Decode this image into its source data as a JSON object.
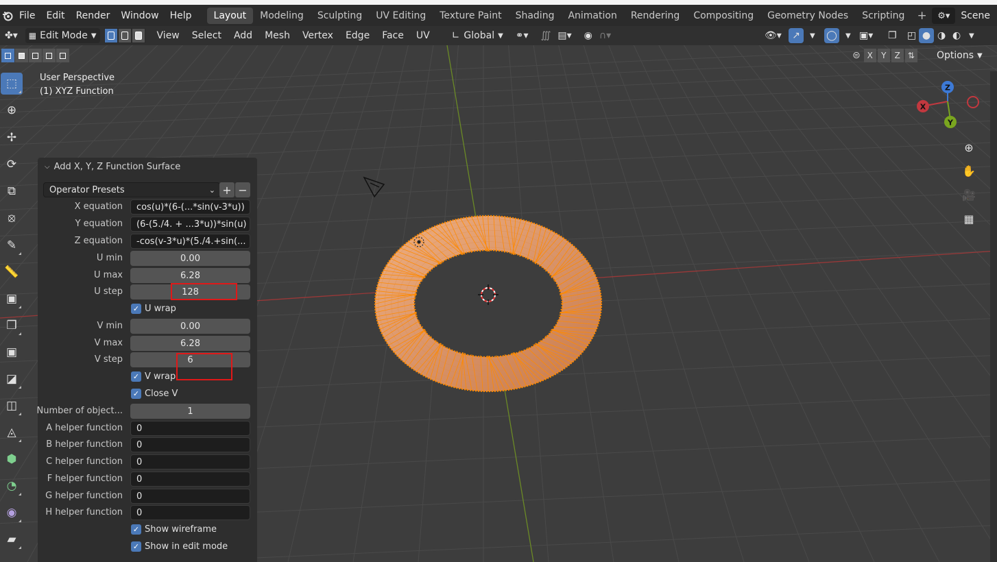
{
  "menubar": {
    "items": [
      "File",
      "Edit",
      "Render",
      "Window",
      "Help"
    ],
    "workspaces": [
      "Layout",
      "Modeling",
      "Sculpting",
      "UV Editing",
      "Texture Paint",
      "Shading",
      "Animation",
      "Rendering",
      "Compositing",
      "Geometry Nodes",
      "Scripting"
    ],
    "active_workspace": "Layout",
    "add_workspace": "+",
    "scene": "Scene"
  },
  "header": {
    "mode": "Edit Mode",
    "menus": [
      "View",
      "Select",
      "Add",
      "Mesh",
      "Vertex",
      "Edge",
      "Face",
      "UV"
    ],
    "transform_orientation": "Global"
  },
  "viewport": {
    "perspective": "User Perspective",
    "object": "(1) XYZ Function",
    "axis_labels": {
      "x": "X",
      "y": "Y",
      "z": "Z"
    },
    "mirror_axes": [
      "X",
      "Y",
      "Z"
    ],
    "options_label": "Options"
  },
  "operator_panel": {
    "title": "Add X, Y, Z Function Surface",
    "presets_label": "Operator Presets",
    "add_preset": "+",
    "remove_preset": "−",
    "x_equation": {
      "label": "X equation",
      "value": "cos(u)*(6-(...*sin(v-3*u))"
    },
    "y_equation": {
      "label": "Y equation",
      "value": "(6-(5./4. + ...3*u))*sin(u)"
    },
    "z_equation": {
      "label": "Z equation",
      "value": "-cos(v-3*u)*(5./4.+sin(..."
    },
    "u_min": {
      "label": "U min",
      "value": "0.00"
    },
    "u_max": {
      "label": "U max",
      "value": "6.28"
    },
    "u_step": {
      "label": "U step",
      "value": "128"
    },
    "u_wrap": {
      "label": "U wrap",
      "checked": true
    },
    "v_min": {
      "label": "V min",
      "value": "0.00"
    },
    "v_max": {
      "label": "V max",
      "value": "6.28"
    },
    "v_step": {
      "label": "V step",
      "value": "6"
    },
    "v_wrap": {
      "label": "V wrap",
      "checked": true
    },
    "close_v": {
      "label": "Close V",
      "checked": true
    },
    "num_objects": {
      "label": "Number of object...",
      "value": "1"
    },
    "a_helper": {
      "label": "A helper function",
      "value": "0"
    },
    "b_helper": {
      "label": "B helper function",
      "value": "0"
    },
    "c_helper": {
      "label": "C helper function",
      "value": "0"
    },
    "f_helper": {
      "label": "F helper function",
      "value": "0"
    },
    "g_helper": {
      "label": "G helper function",
      "value": "0"
    },
    "h_helper": {
      "label": "H helper function",
      "value": "0"
    },
    "show_wireframe": {
      "label": "Show wireframe",
      "checked": true
    },
    "show_in_edit_mode": {
      "label": "Show in edit mode",
      "checked": true
    }
  },
  "colors": {
    "accent": "#4b79b8",
    "selection_orange": "#ff8a00",
    "highlight_red": "#e01818",
    "x_axis": "#c2383f",
    "y_axis": "#7aa51f",
    "z_axis": "#3d7ad6"
  },
  "icons": [
    "blender-logo",
    "select-box-icon",
    "cursor-icon",
    "move-icon",
    "rotate-icon",
    "scale-icon",
    "transform-icon",
    "annotate-icon",
    "measure-icon",
    "add-cube-icon",
    "extrude-icon",
    "inset-icon",
    "bevel-icon",
    "loop-cut-icon",
    "knife-icon",
    "poly-build-icon",
    "spin-icon",
    "smooth-icon",
    "shear-icon",
    "zoom-icon",
    "pan-hand-icon",
    "camera-icon",
    "grid-icon"
  ]
}
